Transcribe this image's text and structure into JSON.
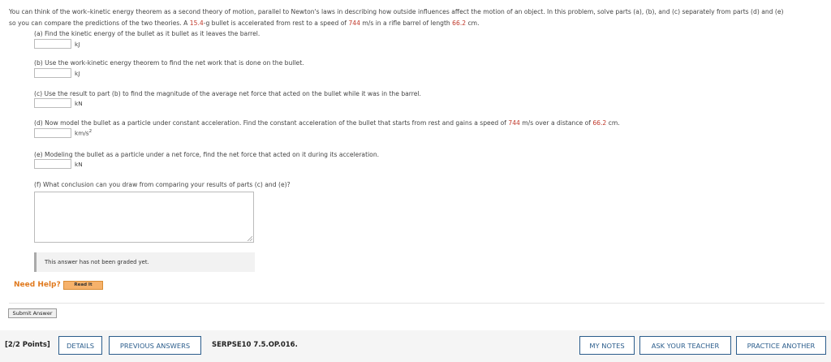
{
  "intro": {
    "line1": "You can think of the work–kinetic energy theorem as a second theory of motion, parallel to Newton's laws in describing how outside influences affect the motion of an object. In this problem, solve parts (a), (b), and (c) separately from parts (d) and (e)",
    "line2_pre": "so you can compare the predictions of the two theories. A ",
    "mass_value": "15.4",
    "line2_mid1": "-g bullet is accelerated from rest to a speed of ",
    "speed_value": "744",
    "line2_mid2": " m/s in a rifle barrel of length ",
    "length_value": "66.2",
    "line2_end": " cm."
  },
  "parts": {
    "a": {
      "prompt": "(a) Find the kinetic energy of the bullet as it bullet as it leaves the barrel.",
      "unit": "kJ",
      "value": ""
    },
    "b": {
      "prompt": "(b) Use the work-kinetic energy theorem to find the net work that is done on the bullet.",
      "unit": "kJ",
      "value": ""
    },
    "c": {
      "prompt": "(c) Use the result to part (b) to find the magnitude of the average net force that acted on the bullet while it was in the barrel.",
      "unit": "kN",
      "value": ""
    },
    "d": {
      "prompt_pre": "(d) Now model the bullet as a particle under constant acceleration. Find the constant acceleration of the bullet that starts from rest and gains a speed of ",
      "speed": "744",
      "prompt_mid": " m/s over a distance of ",
      "distance": "66.2",
      "prompt_end": " cm.",
      "unit": "km/s",
      "unit_exp": "2",
      "value": ""
    },
    "e": {
      "prompt": "(e) Modeling the bullet as a particle under a net force, find the net force that acted on it during its acceleration.",
      "unit": "kN",
      "value": ""
    },
    "f": {
      "prompt": "(f) What conclusion can you draw from comparing your results of parts (c) and (e)?"
    }
  },
  "graded_note": "This answer has not been graded yet.",
  "help": {
    "label": "Need Help?",
    "read_it": "Read It"
  },
  "submit_label": "Submit Answer",
  "footer": {
    "points": "[2/2 Points]",
    "details": "DETAILS",
    "previous_answers": "PREVIOUS ANSWERS",
    "problem_code": "SERPSE10 7.5.OP.016.",
    "my_notes": "MY NOTES",
    "ask_teacher": "ASK YOUR TEACHER",
    "practice_another": "PRACTICE ANOTHER"
  },
  "colors": {
    "highlight_red": "#c0392b",
    "help_orange": "#e07a1f",
    "button_blue": "#2b5d8c"
  }
}
